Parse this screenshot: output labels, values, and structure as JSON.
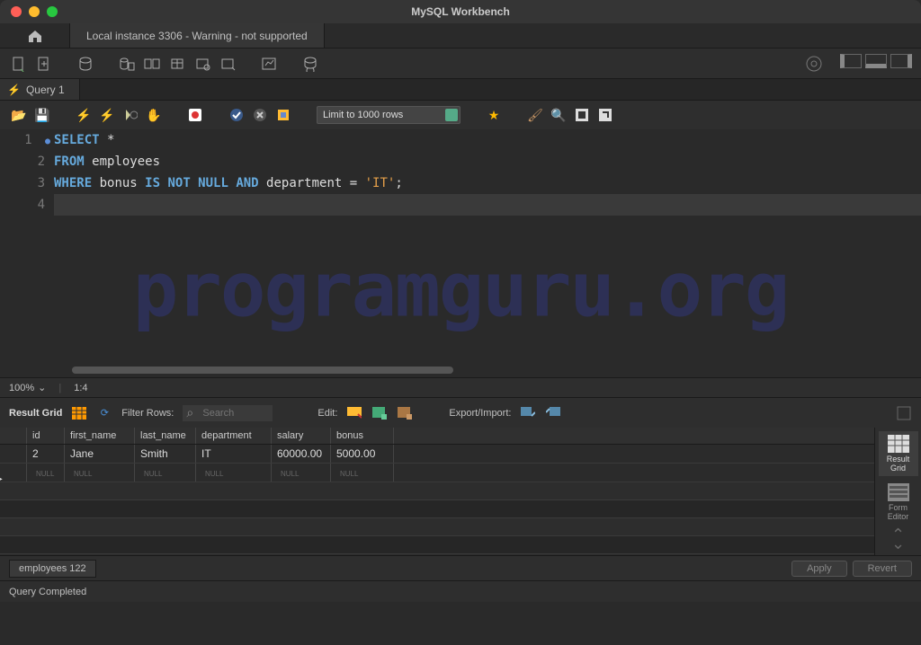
{
  "window": {
    "title": "MySQL Workbench"
  },
  "connection_tab": "Local instance 3306 - Warning - not supported",
  "query_tab": "Query 1",
  "limit": "Limit to 1000 rows",
  "zoom": "100%",
  "cursor_pos": "1:4",
  "sql": {
    "line1_select": "SELECT",
    "line1_star": " *",
    "line2_from": "FROM",
    "line2_tbl": " employees",
    "line3_where": "WHERE",
    "line3_col1": " bonus ",
    "line3_isnotnull": "IS NOT NULL",
    "line3_and": " AND",
    "line3_col2": " department ",
    "line3_eq": "= ",
    "line3_str": "'IT'",
    "line3_semi": ";"
  },
  "watermark": "programguru.org",
  "result_toolbar": {
    "label": "Result Grid",
    "filter_label": "Filter Rows:",
    "search_placeholder": "Search",
    "edit_label": "Edit:",
    "export_label": "Export/Import:"
  },
  "columns": [
    "id",
    "first_name",
    "last_name",
    "department",
    "salary",
    "bonus"
  ],
  "rows": [
    {
      "id": "2",
      "first_name": "Jane",
      "last_name": "Smith",
      "department": "IT",
      "salary": "60000.00",
      "bonus": "5000.00"
    }
  ],
  "null_label": "NULL",
  "side": {
    "result_grid": "Result\nGrid",
    "form_editor": "Form\nEditor"
  },
  "bottom_tab": "employees 122",
  "apply": "Apply",
  "revert": "Revert",
  "status": "Query Completed"
}
